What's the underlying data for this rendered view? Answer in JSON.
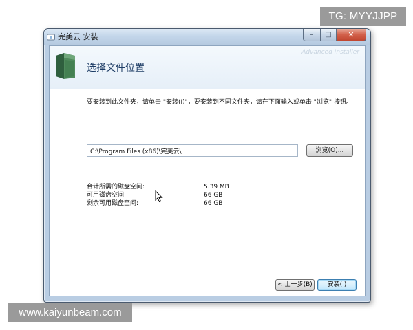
{
  "overlays": {
    "tg_badge": "TG: MYYJJPP",
    "site_watermark": "www.kaiyunbeam.com"
  },
  "window": {
    "title": "完美云 安装",
    "controls": {
      "minimize": "–",
      "maximize": "□",
      "close": "✕"
    },
    "brand_watermark": "Advanced Installer"
  },
  "page": {
    "step_title": "选择文件位置",
    "instruction": "要安装到此文件夹，请单击 \"安装(I)\"，要安装到不同文件夹，请在下面输入或单击 \"浏览\" 按钮。"
  },
  "install_path": {
    "value": "C:\\Program Files (x86)\\完美云\\"
  },
  "buttons": {
    "browse": "浏览(O)...",
    "back": "< 上一步(B)",
    "install": "安装(I)"
  },
  "disk_space": {
    "required_label": "合计所需的磁盘空间:",
    "required_value": "5.39 MB",
    "available_label": "可用磁盘空间:",
    "available_value": "66 GB",
    "remaining_label": "剩余可用磁盘空间:",
    "remaining_value": "66 GB"
  },
  "icons": {
    "app": "app-icon",
    "folder": "folder-icon",
    "cursor": "mouse-cursor-icon"
  },
  "colors": {
    "title_text": "#1e3d66",
    "window_frame": "#b9cde3",
    "close_button": "#c0452f"
  }
}
